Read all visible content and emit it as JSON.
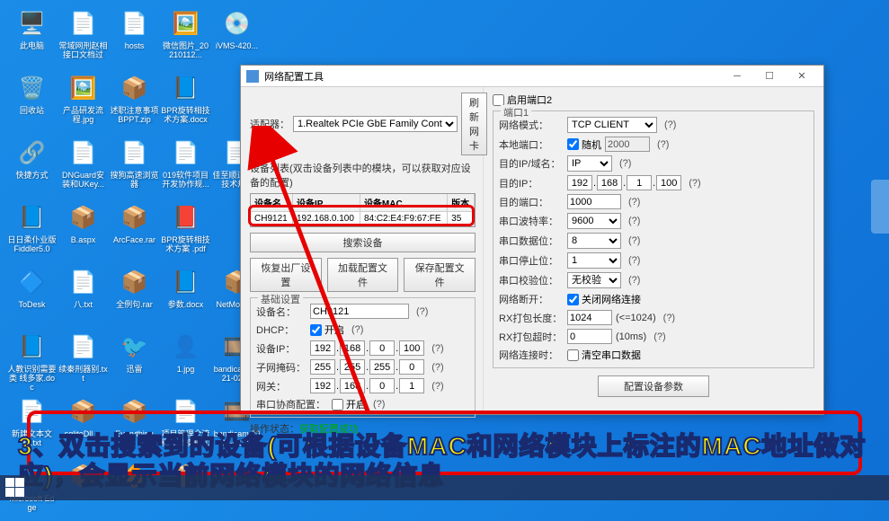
{
  "desktop_icons": [
    {
      "label": "此电脑",
      "glyph": "🖥️"
    },
    {
      "label": "常域网刑赵相接口文档过",
      "glyph": "📄"
    },
    {
      "label": "hosts",
      "glyph": "📄"
    },
    {
      "label": "微信图片_20210112...",
      "glyph": "🖼️"
    },
    {
      "label": "iVMS-420...",
      "glyph": "💿"
    },
    {
      "label": "回收站",
      "glyph": "🗑️"
    },
    {
      "label": "产品研发流程.jpg",
      "glyph": "🖼️"
    },
    {
      "label": "述职注意事项BPPT.zip",
      "glyph": "📦"
    },
    {
      "label": "BPR旋转相技术方案.docx",
      "glyph": "📘"
    },
    {
      "label": "",
      "glyph": ""
    },
    {
      "label": "快捷方式",
      "glyph": "🔗"
    },
    {
      "label": "DNGuard安装和UKey...",
      "glyph": "📄"
    },
    {
      "label": "搜狗高速浏览器",
      "glyph": "📄"
    },
    {
      "label": "019软件项目开发协作规...",
      "glyph": "📄"
    },
    {
      "label": "佳至顺道长八技术规...",
      "glyph": "📄"
    },
    {
      "label": "日日柔仆业版 Fiddler5.0",
      "glyph": "📘"
    },
    {
      "label": "B.aspx",
      "glyph": "📦"
    },
    {
      "label": "ArcFace.rar",
      "glyph": "📦"
    },
    {
      "label": "BPR旋转相技术方案 .pdf",
      "glyph": "📕"
    },
    {
      "label": "",
      "glyph": ""
    },
    {
      "label": "ToDesk",
      "glyph": "🔷"
    },
    {
      "label": "八.txt",
      "glyph": "📄"
    },
    {
      "label": "全例句.rar",
      "glyph": "📦"
    },
    {
      "label": "参数.docx",
      "glyph": "📘"
    },
    {
      "label": "NetModul...",
      "glyph": "📦"
    },
    {
      "label": "人教识别需要类 线多家.doc",
      "glyph": "📘"
    },
    {
      "label": "续秦刑器别.txt",
      "glyph": "📄"
    },
    {
      "label": "迅雷",
      "glyph": "🐦"
    },
    {
      "label": "1.jpg",
      "glyph": "👤"
    },
    {
      "label": "bandicam 2021-02-...",
      "glyph": "🎞️"
    },
    {
      "label": "新建文本文档.txt",
      "glyph": "📄"
    },
    {
      "label": "sqliteDll ...",
      "glyph": "📦"
    },
    {
      "label": "Everything",
      "glyph": "📦"
    },
    {
      "label": "项目管理全流程文档模板20",
      "glyph": "📄"
    },
    {
      "label": "bandicam 2021-02-22",
      "glyph": "🎞️"
    },
    {
      "label": "Microsoft Edge",
      "glyph": "🌐"
    },
    {
      "label": "",
      "glyph": "📦"
    },
    {
      "label": "",
      "glyph": "🔶"
    },
    {
      "label": "",
      "glyph": "📦"
    }
  ],
  "window": {
    "title": "网络配置工具",
    "adapter_label": "适配器：",
    "adapter_value": "1.Realtek PCIe GbE Family Cont",
    "refresh_btn": "刷新网卡",
    "device_list_hint": "设备列表(双击设备列表中的模块，可以获取对应设备的配置)",
    "table_headers": [
      "设备名",
      "设备IP",
      "设备MAC",
      "版本"
    ],
    "table_row": [
      "CH9121",
      "192.168.0.100",
      "84:C2:E4:F9:67:FE",
      "35"
    ],
    "search_btn": "搜索设备",
    "restore_btn": "恢复出厂设置",
    "load_btn": "加载配置文件",
    "save_btn": "保存配置文件",
    "basic_legend": "基础设置",
    "device_name_label": "设备名：",
    "device_name": "CH9121",
    "dhcp_label": "DHCP：",
    "dhcp_open": "开启",
    "device_ip_label": "设备IP：",
    "device_ip": [
      "192",
      "168",
      "0",
      "100"
    ],
    "subnet_label": "子网掩码：",
    "subnet": [
      "255",
      "255",
      "255",
      "0"
    ],
    "gateway_label": "网关：",
    "gateway": [
      "192",
      "168",
      "0",
      "1"
    ],
    "serial_neg_label": "串口协商配置：",
    "serial_neg_open": "开启",
    "status_label": "操作状态：",
    "status_text": "获取配置成功"
  },
  "right": {
    "enable_port2": "启用端口2",
    "port1_label": "端口1",
    "net_mode_label": "网络模式：",
    "net_mode": "TCP CLIENT",
    "local_port_label": "本地端口：",
    "random": "随机",
    "local_port": "2000",
    "dest_ip_label": "目的IP/域名：",
    "dest_ip_type": "IP",
    "dest_ip": "目的IP：",
    "dest_ip_val": [
      "192",
      "168",
      "1",
      "100"
    ],
    "dest_port_label": "目的端口：",
    "dest_port": "1000",
    "baud_label": "串口波特率：",
    "baud": "9600",
    "data_bits_label": "串口数据位：",
    "data_bits": "8",
    "stop_bits_label": "串口停止位：",
    "stop_bits": "1",
    "parity_label": "串口校验位：",
    "parity": "无校验",
    "disconnect_label": "网络断开：",
    "disconnect_text": "关闭网络连接",
    "rx_pkt_label": "RX打包长度：",
    "rx_pkt": "1024",
    "rx_pkt_hint": "(<=1024)",
    "rx_timeout_label": "RX打包超时：",
    "rx_timeout": "0",
    "rx_timeout_hint": "(10ms)",
    "net_reconnect_label": "网络连接时：",
    "net_reconnect_text": "清空串口数据",
    "config_btn": "配置设备参数"
  },
  "annotation": {
    "text": "3、双击搜索到的设备(可根据设备MAC和网络模块上标注的MAC地址做对应)，会显示当前网络模块的网络信息"
  }
}
